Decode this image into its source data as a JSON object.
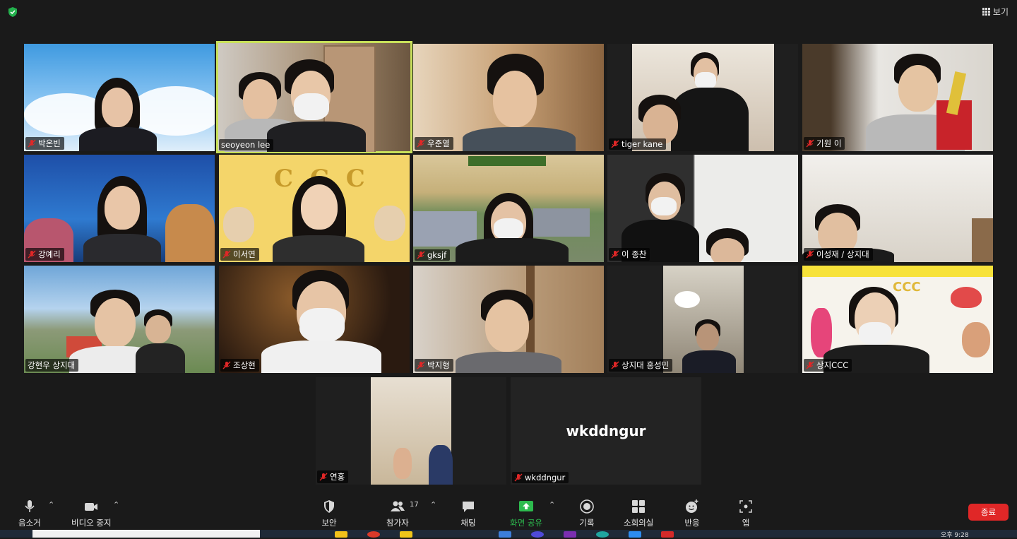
{
  "top": {
    "view_label": "보기"
  },
  "participants": [
    {
      "name": "박온빈"
    },
    {
      "name": "seoyeon lee"
    },
    {
      "name": "우준열"
    },
    {
      "name": "tiger kane"
    },
    {
      "name": "기원 이"
    },
    {
      "name": "강예리"
    },
    {
      "name": "이서연"
    },
    {
      "name": "gksjf"
    },
    {
      "name": "이 종찬"
    },
    {
      "name": "이성재 / 상지대"
    },
    {
      "name": "강현우 상지대"
    },
    {
      "name": "조상현"
    },
    {
      "name": "박지형"
    },
    {
      "name": "상지대 홍성민"
    },
    {
      "name": "상지CCC"
    },
    {
      "name": "연홍"
    },
    {
      "name": "wkddngur"
    }
  ],
  "no_video_display_name": "wkddngur",
  "background_texts": {
    "ccc_banner": "C C C",
    "ccc_poster": "CCC"
  },
  "toolbar": {
    "mute": "음소거",
    "video": "비디오 중지",
    "security": "보안",
    "participants": "참가자",
    "participants_count": "17",
    "chat": "채팅",
    "share": "화면 공유",
    "record": "기록",
    "breakout": "소회의실",
    "reactions": "반응",
    "apps": "앱",
    "end": "종료"
  },
  "taskbar": {
    "clock": "오후 9:28"
  },
  "colors": {
    "background": "#1a1a1a",
    "active_speaker": "#c8e05a",
    "share_green": "#2dbb4e",
    "end_red": "#e02727",
    "mute_red": "#e02727"
  }
}
